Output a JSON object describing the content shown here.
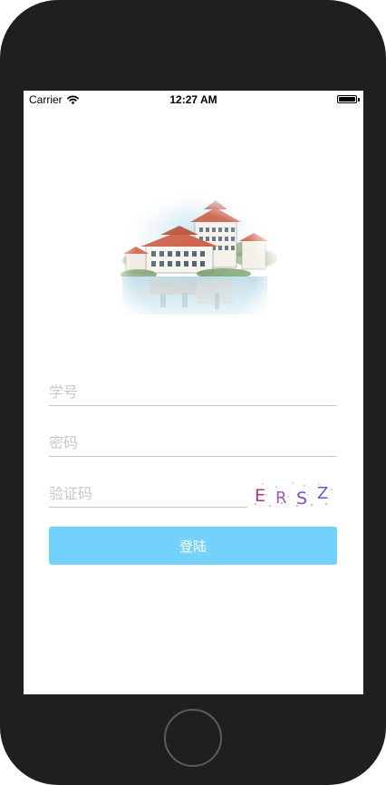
{
  "status_bar": {
    "carrier": "Carrier",
    "time": "12:27 AM",
    "battery_level": 1.0
  },
  "login_form": {
    "student_id_placeholder": "学号",
    "password_placeholder": "密码",
    "captcha_placeholder": "验证码",
    "captcha_text": [
      "E",
      "R",
      "S",
      "Z"
    ],
    "captcha_colors": [
      "#b0308c",
      "#9a5ab8",
      "#8e44c8",
      "#5a5fd8"
    ],
    "login_label": "登陆"
  },
  "theme": {
    "button_color": "#72d2fb",
    "frame_color": "#1f1f1f",
    "divider_color": "#c9c9c9",
    "placeholder_color": "#c7c7cd"
  },
  "icons": {
    "wifi": "wifi-icon",
    "battery": "battery-icon",
    "home": "home-button",
    "illustration": "campus-illustration"
  }
}
